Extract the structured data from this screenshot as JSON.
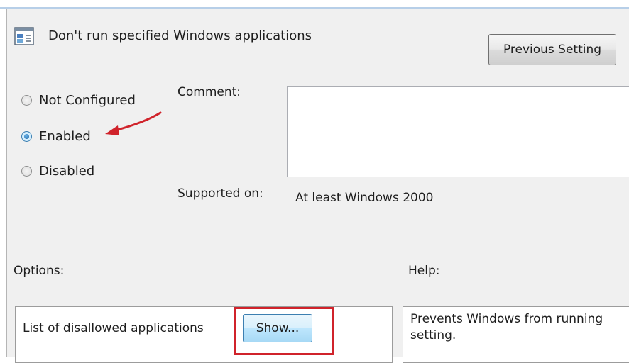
{
  "policy": {
    "title": "Don't run specified Windows applications",
    "icon": "policy-setting-icon"
  },
  "buttons": {
    "previous_setting": "Previous Setting",
    "show": "Show..."
  },
  "state_options": [
    {
      "label": "Not Configured",
      "checked": false
    },
    {
      "label": "Enabled",
      "checked": true
    },
    {
      "label": "Disabled",
      "checked": false
    }
  ],
  "comment": {
    "label": "Comment:",
    "value": ""
  },
  "supported": {
    "label": "Supported on:",
    "value": "At least Windows 2000"
  },
  "options": {
    "label": "Options:",
    "item_label": "List of disallowed applications"
  },
  "help": {
    "label": "Help:",
    "line1": "Prevents Windows from running",
    "line2": "setting."
  },
  "colors": {
    "annotation": "#d0232b",
    "dialog_bg": "#f0f0f0"
  }
}
